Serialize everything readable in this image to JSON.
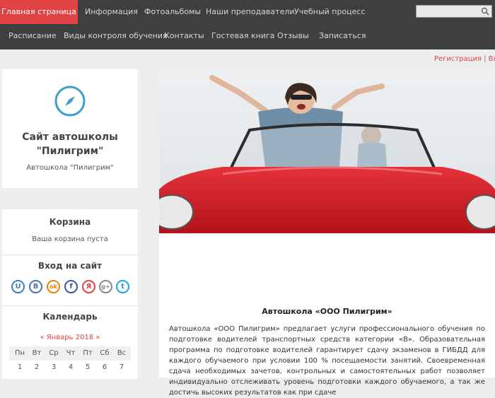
{
  "nav": {
    "row1": [
      "Главная страница",
      "Информация",
      "Фотоальбомы",
      "Наши преподаватели",
      "Учебный процесс"
    ],
    "row2": [
      "Расписание",
      "Виды контроля обучения",
      "Контакты",
      "Гостевая книга",
      "Отзывы",
      "Записаться"
    ],
    "active_color": "#e04343",
    "background": "#3f3f3f"
  },
  "search": {
    "placeholder": ""
  },
  "top_links": {
    "register": "Регистрация",
    "separator": "|",
    "login": "Вход"
  },
  "site": {
    "title_line1": "Сайт автошколы",
    "title_line2": "\"Пилигрим\"",
    "subtitle": "Автошкола \"Пилигрим\"",
    "logo_icon": "compass-icon"
  },
  "cart": {
    "title": "Корзина",
    "text": "Ваша корзина пуста"
  },
  "login": {
    "title": "Вход на сайт",
    "providers": [
      {
        "icon": "ucoz-icon",
        "glyph": "U",
        "color": "#3b7fc4"
      },
      {
        "icon": "vk-icon",
        "glyph": "B",
        "color": "#4a76a8"
      },
      {
        "icon": "odnoklassniki-icon",
        "glyph": "ok",
        "color": "#ee8208"
      },
      {
        "icon": "facebook-icon",
        "glyph": "f",
        "color": "#3b5998"
      },
      {
        "icon": "yandex-icon",
        "glyph": "Я",
        "color": "#e04343"
      },
      {
        "icon": "googleplus-icon",
        "glyph": "g+",
        "color": "#888888"
      },
      {
        "icon": "twitter-icon",
        "glyph": "t",
        "color": "#1da1f2"
      }
    ]
  },
  "calendar": {
    "title": "Календарь",
    "prev": "«",
    "month": "Январь 2018",
    "next": "»",
    "weekdays": [
      "Пн",
      "Вт",
      "Ср",
      "Чт",
      "Пт",
      "Сб",
      "Вс"
    ],
    "days": [
      "1",
      "2",
      "3",
      "4",
      "5",
      "6",
      "7"
    ]
  },
  "main": {
    "title": "Автошкола «ООО Пилигрим»",
    "text": "Автошкола «ООО Пилигрим» предлагает услуги профессионального обучения по подготовке водителей транспортных средств категории «B». Образовательная программа по подготовке водителей гарантирует сдачу экзаменов в ГИБДД для каждого обучаемого при условии 100 % посещаемости занятий. Своевременная сдача необходимых зачетов, контрольных и самостоятельных работ позволяет индивидуально отслеживать уровень подготовки каждого обучаемого, а так же достичь высоких результатов как при сдаче"
  },
  "colors": {
    "accent": "#e04343",
    "car_red": "#d81f26",
    "page_bg": "#eeeeee"
  }
}
